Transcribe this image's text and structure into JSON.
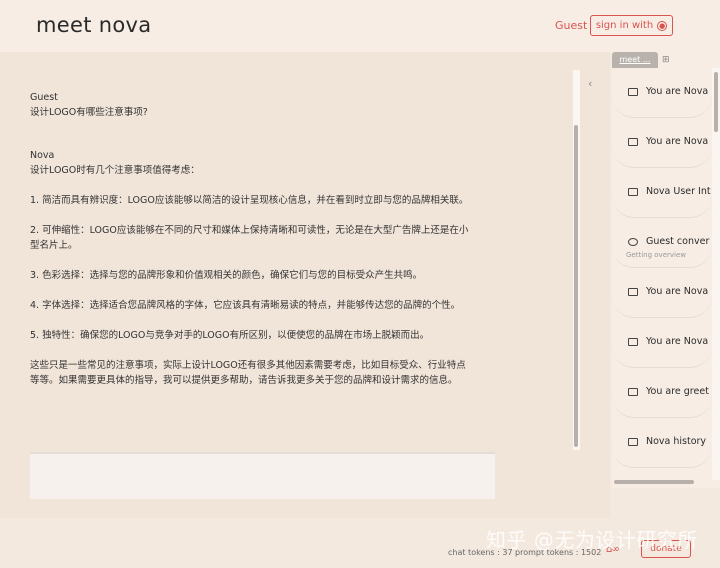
{
  "header": {
    "logo": "meet nova",
    "user_label": "Guest",
    "signin_label": "sign in with"
  },
  "chat": {
    "user_author": "Guest",
    "user_message": "设计LOGO有哪些注意事项?",
    "bot_author": "Nova",
    "bot_paragraphs": [
      "设计LOGO时有几个注意事项值得考虑：",
      "1. 简洁而具有辨识度：LOGO应该能够以简洁的设计呈现核心信息，并在看到时立即与您的品牌相关联。",
      "2. 可伸缩性：LOGO应该能够在不同的尺寸和媒体上保持清晰和可读性，无论是在大型广告牌上还是在小型名片上。",
      "3. 色彩选择：选择与您的品牌形象和价值观相关的颜色，确保它们与您的目标受众产生共鸣。",
      "4. 字体选择：选择适合您品牌风格的字体，它应该具有清晰易读的特点，并能够传达您的品牌的个性。",
      "5. 独特性：确保您的LOGO与竞争对手的LOGO有所区别，以便使您的品牌在市场上脱颖而出。",
      "这些只是一些常见的注意事项，实际上设计LOGO还有很多其他因素需要考虑，比如目标受众、行业特点等等。如果需要更具体的指导，我可以提供更多帮助，请告诉我更多关于您的品牌和设计需求的信息。"
    ]
  },
  "sidebar": {
    "tab_label": "meet ...",
    "conversations": [
      {
        "title": "You are Nova",
        "icon": "message-icon",
        "subtitle": ""
      },
      {
        "title": "You are Nova",
        "icon": "message-icon",
        "subtitle": ""
      },
      {
        "title": "Nova User Int",
        "icon": "message-icon",
        "subtitle": ""
      },
      {
        "title": "Guest conver",
        "icon": "chat-bubble-icon",
        "subtitle": "Getting overview"
      },
      {
        "title": "You are Nova",
        "icon": "message-icon",
        "subtitle": ""
      },
      {
        "title": "You are Nova",
        "icon": "message-icon",
        "subtitle": ""
      },
      {
        "title": "You are greet",
        "icon": "message-icon",
        "subtitle": ""
      },
      {
        "title": "Nova history",
        "icon": "message-icon",
        "subtitle": ""
      }
    ]
  },
  "footer": {
    "chat_tokens": "chat tokens : 37",
    "prompt_tokens": "prompt tokens : 1502",
    "donate_label": "donate",
    "watermark": "知乎 @无为设计研究所"
  },
  "colors": {
    "accent": "#d9534f",
    "background": "#f4e9df"
  }
}
